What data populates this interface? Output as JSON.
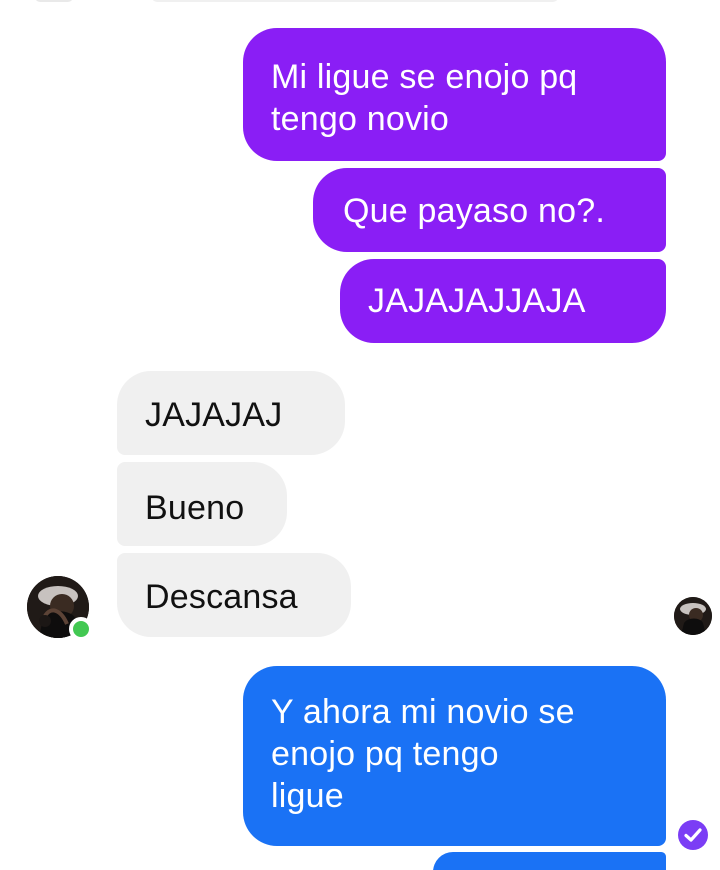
{
  "messages": [
    {
      "id": "m1",
      "sender": "me",
      "color": "#8a1ef5",
      "text": "Mi ligue se enojo pq\ntengo novio"
    },
    {
      "id": "m2",
      "sender": "me",
      "color": "#8a1ef5",
      "text": "Que payaso no?."
    },
    {
      "id": "m3",
      "sender": "me",
      "color": "#8a1ef5",
      "text": "JAJAJAJJAJA"
    },
    {
      "id": "m4",
      "sender": "contact",
      "color": "#f0f0f0",
      "text": "JAJAJAJ"
    },
    {
      "id": "m5",
      "sender": "contact",
      "color": "#f0f0f0",
      "text": "Bueno"
    },
    {
      "id": "m6",
      "sender": "contact",
      "color": "#f0f0f0",
      "text": "Descansa"
    },
    {
      "id": "m7",
      "sender": "me",
      "color": "#1a72f5",
      "text": "Y ahora mi novio se\nenojo pq tengo\nligue"
    },
    {
      "id": "m8",
      "sender": "me",
      "color": "#1a72f5",
      "text": ""
    }
  ],
  "contact": {
    "avatar_icon": "contact-avatar",
    "online_status_color": "#42c852"
  },
  "receipts": {
    "seen_avatar_icon": "seen-avatar",
    "delivered_icon": "delivered-check-icon",
    "delivered_color": "#7b3df5"
  },
  "theme": {
    "outgoing_purple": "#8a1ef5",
    "outgoing_blue": "#1a72f5",
    "incoming_gray": "#f0f0f0"
  }
}
